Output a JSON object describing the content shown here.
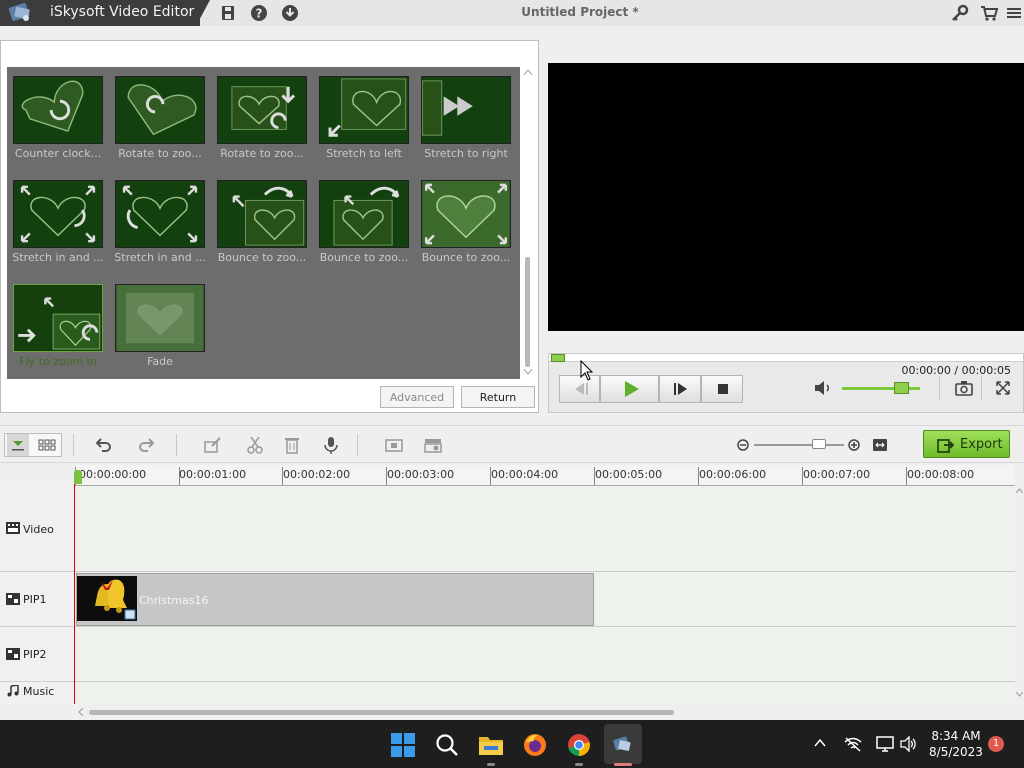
{
  "app": {
    "name": "iSkysoft Video Editor",
    "project_title": "Untitled Project *"
  },
  "transitions": {
    "items": [
      {
        "label": "Counter clock..."
      },
      {
        "label": "Rotate to zoo..."
      },
      {
        "label": "Rotate to zoo..."
      },
      {
        "label": "Stretch to left"
      },
      {
        "label": "Stretch to right"
      },
      {
        "label": "Stretch in and ..."
      },
      {
        "label": "Stretch in and ..."
      },
      {
        "label": "Bounce to zoo..."
      },
      {
        "label": "Bounce to zoo..."
      },
      {
        "label": "Bounce to zoo..."
      },
      {
        "label": "Fly to zoom in",
        "selected": true
      },
      {
        "label": "Fade"
      }
    ],
    "advanced_label": "Advanced",
    "return_label": "Return"
  },
  "player": {
    "timecode": "00:00:00 / 00:00:05",
    "volume_level": 0.75
  },
  "toolbar": {
    "export_label": "Export"
  },
  "timeline": {
    "ruler_ticks": [
      "00:00:00:00",
      "00:00:01:00",
      "00:00:02:00",
      "00:00:03:00",
      "00:00:04:00",
      "00:00:05:00",
      "00:00:06:00",
      "00:00:07:00",
      "00:00:08:00"
    ],
    "tracks": [
      {
        "label": "Video"
      },
      {
        "label": "PIP1"
      },
      {
        "label": "PIP2"
      },
      {
        "label": "Music"
      }
    ],
    "clip": {
      "name": "Christmas16",
      "track": "PIP1"
    }
  },
  "taskbar": {
    "time": "8:34 AM",
    "date": "8/5/2023",
    "notification_count": "1"
  },
  "colors": {
    "accent_green": "#7dc140",
    "titlebar_dark": "#3c3c3c",
    "playhead": "#dd0000"
  }
}
